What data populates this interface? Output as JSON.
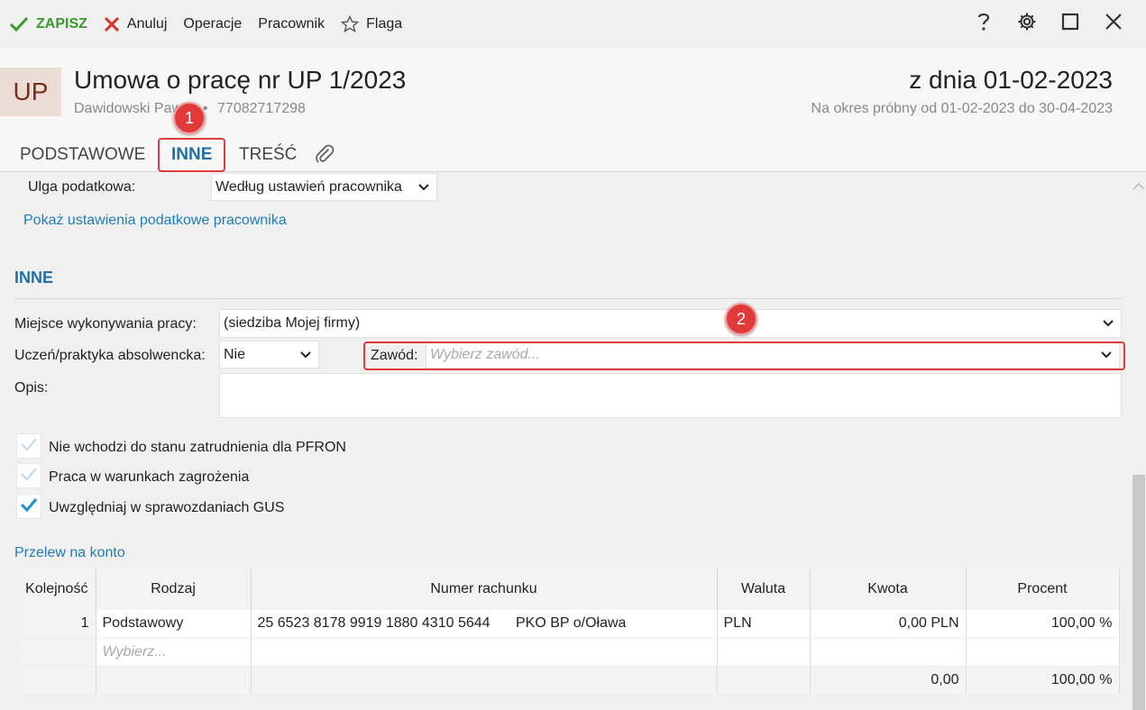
{
  "toolbar": {
    "save": "ZAPISZ",
    "cancel": "Anuluj",
    "operations": "Operacje",
    "employee": "Pracownik",
    "flag": "Flaga"
  },
  "header": {
    "avatar": "UP",
    "title": "Umowa o pracę nr UP 1/2023",
    "subtitle_name": "Dawidowski Paweł",
    "subtitle_sep": "•",
    "subtitle_id": "77082717298",
    "date": "z dnia 01-02-2023",
    "period": "Na okres próbny od 01-02-2023 do 30-04-2023"
  },
  "tabs": [
    "PODSTAWOWE",
    "INNE",
    "TREŚĆ"
  ],
  "tax": {
    "label": "Ulga podatkowa:",
    "value": "Według ustawień pracownika",
    "link": "Pokaż ustawienia podatkowe pracownika"
  },
  "inne": {
    "title": "INNE",
    "workplace_label": "Miejsce wykonywania pracy:",
    "workplace_value": "(siedziba Mojej firmy)",
    "apprentice_label": "Uczeń/praktyka absolwencka:",
    "apprentice_value": "Nie",
    "profession_label": "Zawód:",
    "profession_placeholder": "Wybierz zawód...",
    "description_label": "Opis:"
  },
  "checkboxes": [
    {
      "label": "Nie wchodzi do stanu zatrudnienia dla PFRON",
      "checked": false
    },
    {
      "label": "Praca w warunkach zagrożenia",
      "checked": false
    },
    {
      "label": "Uwzględniaj w sprawozdaniach GUS",
      "checked": true
    }
  ],
  "transfer": {
    "title": "Przelew na konto",
    "columns": [
      "Kolejność",
      "Rodzaj",
      "Numer rachunku",
      "Waluta",
      "Kwota",
      "Procent"
    ],
    "row": {
      "order": "1",
      "type": "Podstawowy",
      "account": "25 6523 8178 9919 1880 4310 5644",
      "bank": "PKO BP o/Oława",
      "currency": "PLN",
      "amount": "0,00 PLN",
      "percent": "100,00 %"
    },
    "new_placeholder": "Wybierz...",
    "sum_amount": "0,00",
    "sum_percent": "100,00 %"
  },
  "annotations": [
    "1",
    "2"
  ],
  "colors": {
    "accent": "#1f6fa8",
    "save": "#3a9a2b",
    "cancel": "#d9302c",
    "annotation": "#e03a3a",
    "avatar_bg": "#ecdcd6",
    "avatar_text": "#7a2e1d"
  }
}
